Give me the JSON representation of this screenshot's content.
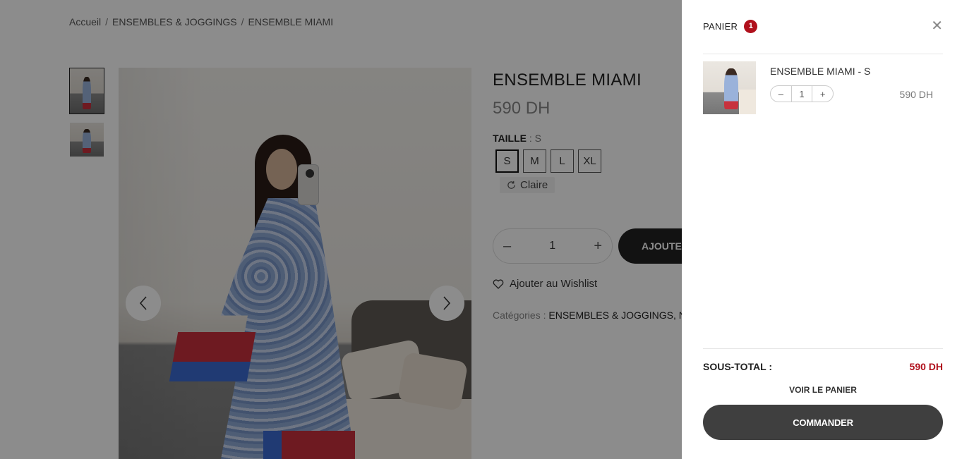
{
  "breadcrumb": [
    "Accueil",
    "ENSEMBLES & JOGGINGS",
    "ENSEMBLE MIAMI"
  ],
  "breadcrumb_separator": "/",
  "product": {
    "title": "ENSEMBLE MIAMI",
    "price": "590 DH",
    "size_label": "TAILLE",
    "size_value": ": S",
    "sizes": [
      "S",
      "M",
      "L",
      "XL"
    ],
    "selected_size": "S",
    "clear_label": "Claire",
    "quantity": "1",
    "add_to_cart": "AJOUTER",
    "wishlist": "Ajouter au Wishlist",
    "categories_label": "Catégories :",
    "categories_value": "ENSEMBLES & JOGGINGS, N"
  },
  "gallery": {
    "thumb_count": 2,
    "prev_icon": "chevron-left-icon",
    "next_icon": "chevron-right-icon"
  },
  "cart": {
    "title": "PANIER",
    "count": "1",
    "items": [
      {
        "name": "ENSEMBLE MIAMI - S",
        "qty": "1",
        "price": "590 DH"
      }
    ],
    "subtotal_label": "SOUS-TOTAL :",
    "subtotal_value": "590 DH",
    "view_cart": "VOIR LE PANIER",
    "checkout": "COMMANDER"
  },
  "colors": {
    "accent_red": "#b0101c",
    "dark_button": "#3f3f3f",
    "overlay": "rgba(0,0,0,0.45)"
  }
}
